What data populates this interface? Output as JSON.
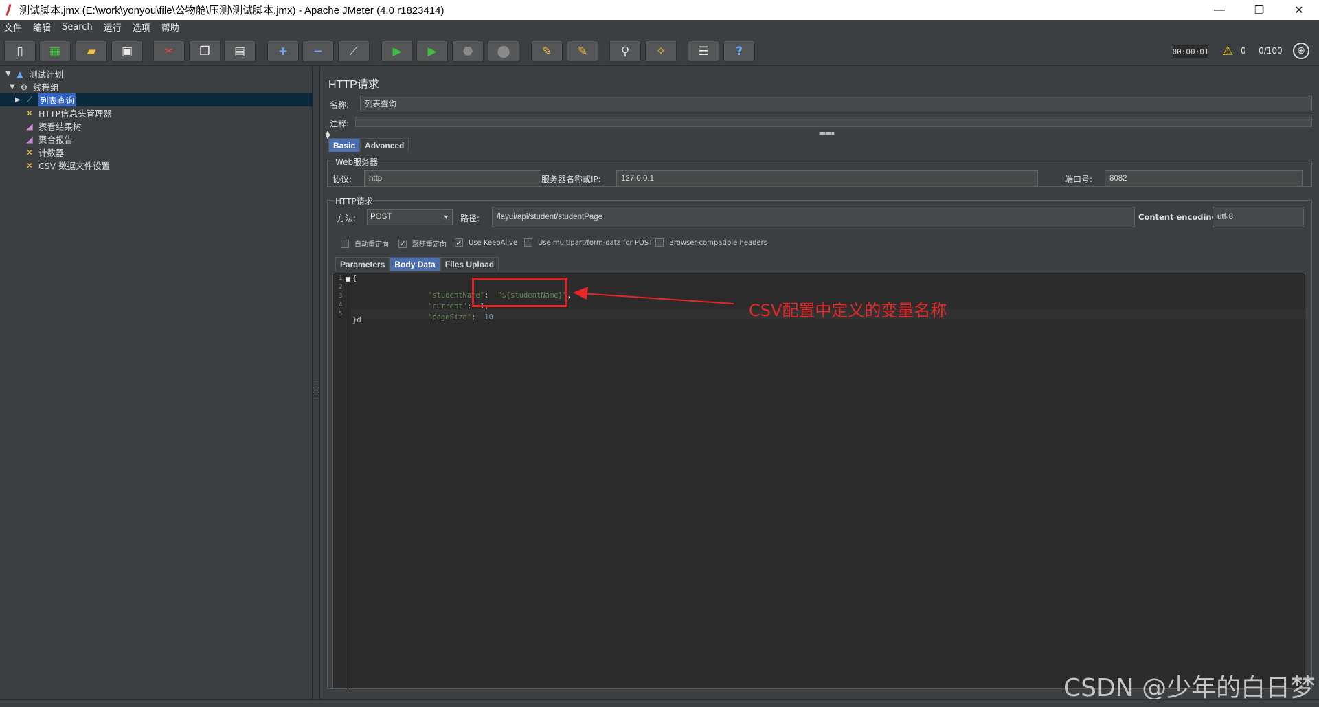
{
  "window": {
    "title": "测试脚本.jmx (E:\\work\\yonyou\\file\\公物舱\\压测\\测试脚本.jmx) - Apache JMeter (4.0 r1823414)",
    "minimize": "—",
    "maximize": "❐",
    "close": "✕"
  },
  "menu": [
    "文件",
    "编辑",
    "Search",
    "运行",
    "选项",
    "帮助"
  ],
  "status": {
    "timer": "00:00:01",
    "warnings": "0",
    "threads": "0/100"
  },
  "tree": [
    {
      "label": "测试计划",
      "icon": "test-plan-icon"
    },
    {
      "label": "线程组",
      "icon": "gear-icon"
    },
    {
      "label": "列表查询",
      "icon": "sampler-icon"
    },
    {
      "label": "HTTP信息头管理器",
      "icon": "config-icon"
    },
    {
      "label": "察看结果树",
      "icon": "listener-icon"
    },
    {
      "label": "聚合报告",
      "icon": "listener-icon"
    },
    {
      "label": "计数器",
      "icon": "config-icon"
    },
    {
      "label": "CSV 数据文件设置",
      "icon": "config-icon"
    }
  ],
  "panel": {
    "title": "HTTP请求",
    "name_label": "名称:",
    "name_value": "列表查询",
    "comment_label": "注释:",
    "tabs": [
      "Basic",
      "Advanced"
    ],
    "web_server": {
      "title": "Web服务器",
      "protocol_label": "协议:",
      "protocol_value": "http",
      "server_label": "服务器名称或IP:",
      "server_value": "127.0.0.1",
      "port_label": "端口号:",
      "port_value": "8082"
    },
    "http_request": {
      "title": "HTTP请求",
      "method_label": "方法:",
      "method_value": "POST",
      "path_label": "路径:",
      "path_value": "/layui/api/student/studentPage",
      "encoding_label": "Content encoding:",
      "encoding_value": "utf-8"
    },
    "checkboxes": [
      {
        "label": "自动重定向",
        "checked": false
      },
      {
        "label": "跟随重定向",
        "checked": true
      },
      {
        "label": "Use KeepAlive",
        "checked": true
      },
      {
        "label": "Use multipart/form-data for POST",
        "checked": false
      },
      {
        "label": "Browser-compatible headers",
        "checked": false
      }
    ],
    "body_tabs": [
      "Parameters",
      "Body Data",
      "Files Upload"
    ],
    "code": {
      "line_numbers": [
        "1",
        "2",
        "3",
        "4",
        "5"
      ],
      "l1": "{",
      "l2_key": "\"studentName\"",
      "l2_colon": ":  ",
      "l2_val": "\"${studentName}\"",
      "l2_end": ",",
      "l3_key": "\"current\"",
      "l3_colon": ":  ",
      "l3_val": "1",
      "l3_end": ",",
      "l4_key": "\"pageSize\"",
      "l4_colon": ":  ",
      "l4_val": "10",
      "l5": "}d"
    }
  },
  "annotation": {
    "text": "CSV配置中定义的变量名称",
    "color": "#e52727"
  },
  "watermark": "CSDN @少年的白日梦"
}
